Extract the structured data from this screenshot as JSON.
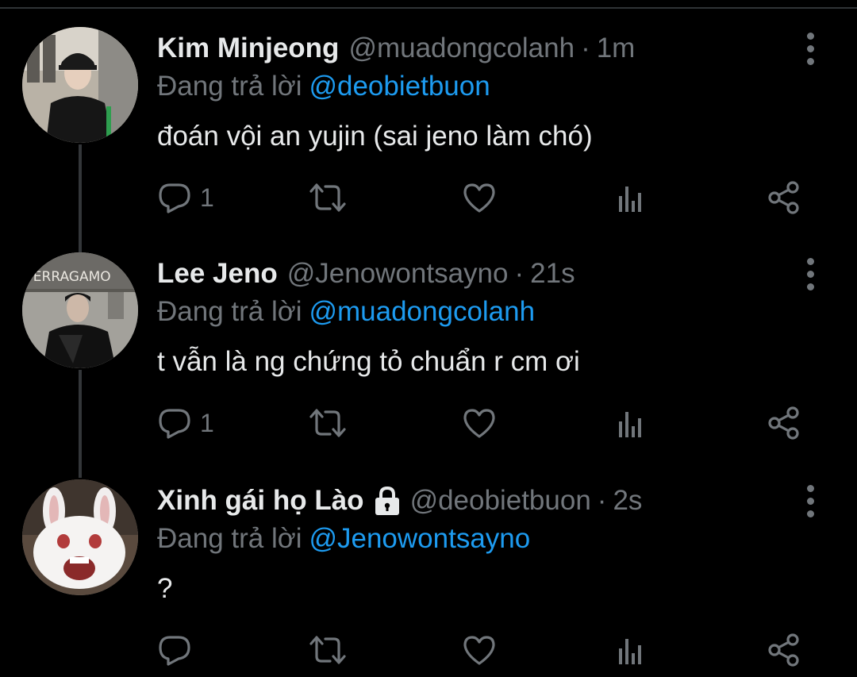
{
  "tweets": [
    {
      "name": "Kim Minjeong",
      "handle": "@muadongcolanh",
      "separator": "·",
      "time": "1m",
      "reply_prefix": "Đang trả lời",
      "reply_to": "@deobietbuon",
      "text": "đoán vội an yujin (sai jeno làm chó)",
      "reply_count": "1",
      "locked": false
    },
    {
      "name": "Lee Jeno",
      "handle": "@Jenowontsayno",
      "separator": "·",
      "time": "21s",
      "reply_prefix": "Đang trả lời",
      "reply_to": "@muadongcolanh",
      "text": "t vẫn là ng chứng tỏ chuẩn r cm ơi",
      "reply_count": "1",
      "avatar_sign_text": "FERRAGAMO",
      "locked": false
    },
    {
      "name": "Xinh gái họ Lào",
      "handle": "@deobietbuon",
      "separator": "·",
      "time": "2s",
      "reply_prefix": "Đang trả lời",
      "reply_to": "@Jenowontsayno",
      "text": "?",
      "reply_count": "",
      "locked": true
    }
  ],
  "colors": {
    "background": "#000000",
    "primary_text": "#e7e9ea",
    "secondary_text": "#71767b",
    "accent": "#1d9bf0",
    "thread_line": "#333639"
  },
  "icons": [
    "reply-icon",
    "retweet-icon",
    "like-icon",
    "views-icon",
    "share-icon",
    "more-icon",
    "lock-icon"
  ]
}
